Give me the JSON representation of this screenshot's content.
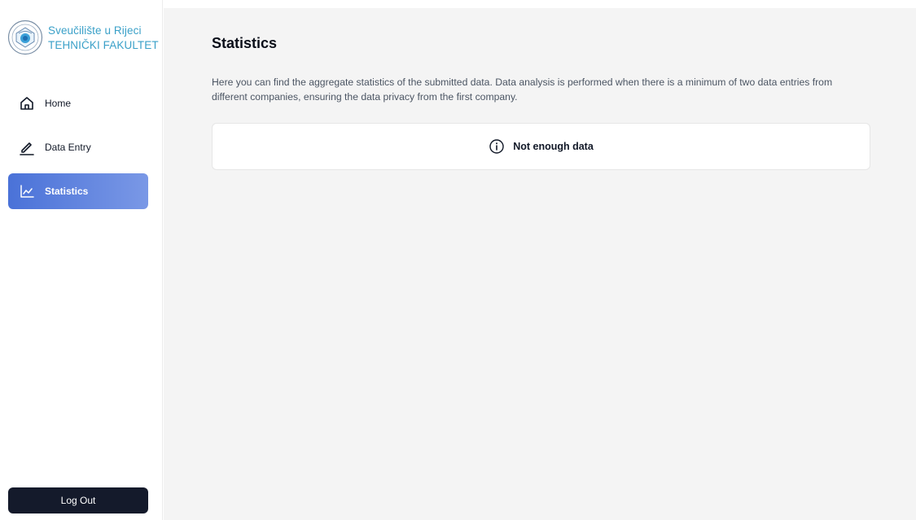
{
  "brand": {
    "line1": "Sveučilište u Rijeci",
    "line2": "TEHNIČKI FAKULTET",
    "logo_icon": "university-seal-icon",
    "color": "#3aa0c8"
  },
  "sidebar": {
    "items": [
      {
        "label": "Home",
        "icon": "home-icon",
        "active": false
      },
      {
        "label": "Data Entry",
        "icon": "pencil-icon",
        "active": false
      },
      {
        "label": "Statistics",
        "icon": "chart-line-icon",
        "active": true
      }
    ],
    "logout_label": "Log Out",
    "active_color": "#4a72d8"
  },
  "main": {
    "title": "Statistics",
    "description": "Here you can find the aggregate statistics of the submitted data. Data analysis is performed when there is a minimum of two data entries from different companies, ensuring the data privacy from the first company.",
    "notice": {
      "icon": "info-icon",
      "text": "Not enough data"
    }
  }
}
